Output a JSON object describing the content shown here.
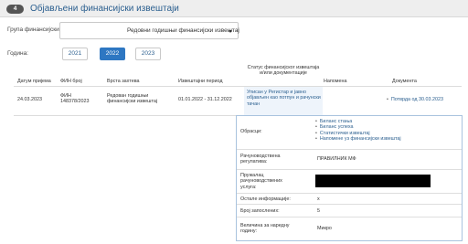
{
  "header": {
    "badge": "4",
    "title": "Објављени финансијски извештаји"
  },
  "filters": {
    "group_label": "Група финансијских извештаја:",
    "group_value": "Редовни годишњи финансијски извештај",
    "year_label": "Година:",
    "years": [
      "2021",
      "2022",
      "2023"
    ],
    "selected_year": "2022"
  },
  "table": {
    "headers": {
      "date": "Датум пријема",
      "fin": "ФИН број",
      "type": "Врста захтева",
      "period": "Извештајни период",
      "status": "Статус финансијског извештаја и/или документације",
      "note": "Напомена",
      "docs": "Документа"
    },
    "row": {
      "date": "24.03.2023",
      "fin": "ФИН 148378/2023",
      "type": "Редован годишњи финансијски извештај",
      "period": "01.01.2022 - 31.12.2022",
      "status": "Уписан у Регистар и јавно објављен као потпун и рачунски тачан",
      "note": "",
      "doc": "Потврда од 30.03.2023"
    }
  },
  "details": {
    "forms_label": "Обрасци:",
    "forms": [
      "Биланс стања",
      "Биланс успеха",
      "Статистички извештај",
      "Напомене уз финансијски извештај"
    ],
    "rules_label": "Рачуноводствена регулатива:",
    "rules_value": "ПРАВИЛНИК МФ",
    "provider_label": "Пружалац рачуноводствених услуга:",
    "other_label": "Остале информације:",
    "other_value": "x",
    "employees_label": "Број запослених:",
    "employees_value": "5",
    "size_label": "Величина за наредну годину:",
    "size_value": "Микро"
  }
}
